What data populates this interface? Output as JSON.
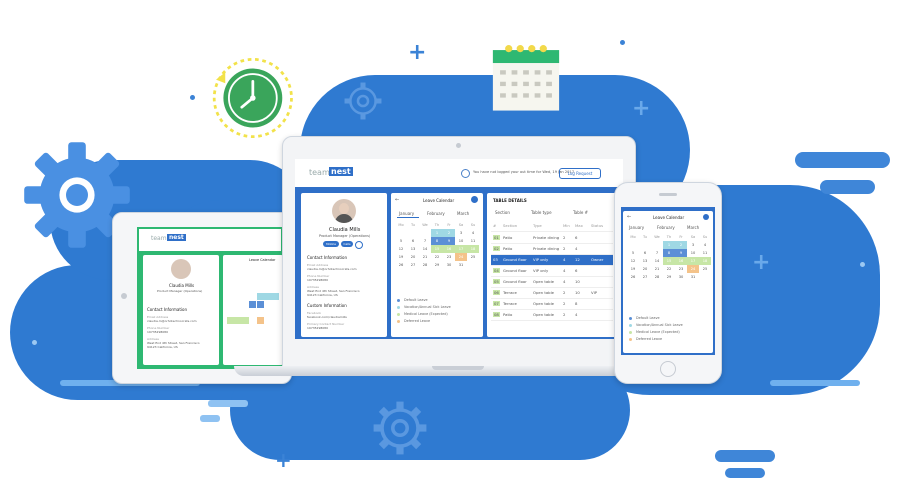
{
  "brand": {
    "logo_prefix": "team",
    "logo_suffix": "nest"
  },
  "profile": {
    "name": "Claudia Mills",
    "role": "Product Manager (Operations)",
    "badge1": "Mobile",
    "badge2": "Calls",
    "contact_heading": "Contact Information",
    "email_label": "Email Address",
    "email": "claudia.m@orhotechnocrats.com",
    "phone_label": "Phone Number",
    "phone": "19735298080",
    "address_label": "Address",
    "address_line1": "West End 4th Street, San Francisco",
    "address_line2": "94123 California, US",
    "custom_heading": "Custom Information",
    "facebook_label": "Facebook",
    "facebook": "facebook.com/claudiamills",
    "primary_label": "Primary Contact Number",
    "primary": "19735298080"
  },
  "laptop_header": {
    "notice": "You have not logged your out time for Wed, 19 Jan 2017.",
    "button": "Log Request"
  },
  "calendar": {
    "title": "Leave Calendar",
    "months": [
      "January",
      "February",
      "March"
    ],
    "weekdays": [
      "Mo",
      "Tu",
      "We",
      "Th",
      "Fr",
      "Sa",
      "Su"
    ],
    "days": [
      "",
      "",
      "",
      "1",
      "2",
      "3",
      "4",
      "5",
      "6",
      "7",
      "8",
      "9",
      "10",
      "11",
      "12",
      "13",
      "14",
      "15",
      "16",
      "17",
      "18",
      "19",
      "20",
      "21",
      "22",
      "23",
      "24",
      "25",
      "26",
      "27",
      "28",
      "29",
      "30",
      "31",
      "",
      ""
    ],
    "legend": [
      "Default Leave",
      "Vacation/Annual Sick Leave",
      "Medical Leave (Expected)",
      "Deferred Leave"
    ],
    "legend_colors": [
      "#5b8fd6",
      "#9fd8e4",
      "#c7e6a6",
      "#f4c38a"
    ]
  },
  "table": {
    "title": "TABLE DETAILS",
    "filters": [
      "Section",
      "Table type",
      "Table #"
    ],
    "columns": [
      "#",
      "Section",
      "Type",
      "Min",
      "Max",
      "Status"
    ],
    "rows": [
      {
        "n": "01",
        "section": "Patio",
        "type": "Private dining",
        "min": "2",
        "max": "6",
        "status": ""
      },
      {
        "n": "02",
        "section": "Patio",
        "type": "Private dining",
        "min": "2",
        "max": "4",
        "status": ""
      },
      {
        "n": "03",
        "section": "Ground floor",
        "type": "VIP only",
        "min": "4",
        "max": "12",
        "status": "Owner"
      },
      {
        "n": "04",
        "section": "Ground floor",
        "type": "VIP only",
        "min": "4",
        "max": "6",
        "status": ""
      },
      {
        "n": "05",
        "section": "Ground floor",
        "type": "Open table",
        "min": "4",
        "max": "10",
        "status": ""
      },
      {
        "n": "06",
        "section": "Terrace",
        "type": "Open table",
        "min": "2",
        "max": "10",
        "status": "VIP"
      },
      {
        "n": "07",
        "section": "Terrace",
        "type": "Open table",
        "min": "2",
        "max": "8",
        "status": ""
      },
      {
        "n": "08",
        "section": "Patio",
        "type": "Open table",
        "min": "2",
        "max": "4",
        "status": ""
      }
    ]
  },
  "colors": {
    "cloud": "#2f7ad1",
    "accent_green": "#2eb872",
    "accent_blue": "#2f6fc8",
    "clock": "#3aa55b",
    "clock_ring": "#f2e24a"
  }
}
